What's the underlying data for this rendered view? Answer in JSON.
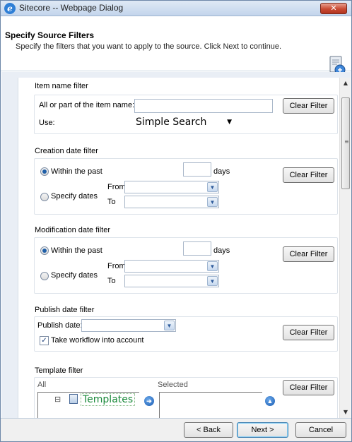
{
  "window": {
    "title": "Sitecore -- Webpage Dialog",
    "close_glyph": "✕"
  },
  "header": {
    "title": "Specify Source Filters",
    "subtitle": "Specify the filters that you want to apply to the source. Click Next to continue."
  },
  "item_name_filter": {
    "section_label": "Item name filter",
    "name_label": "All or part of the item name:",
    "name_value": "",
    "use_label": "Use:",
    "use_selected": "Simple Search",
    "clear_label": "Clear Filter"
  },
  "creation_date_filter": {
    "section_label": "Creation date filter",
    "within_label": "Within the past",
    "within_selected": true,
    "days_value": "",
    "days_label": "days",
    "specify_label": "Specify dates",
    "from_label": "From",
    "to_label": "To",
    "from_value": "",
    "to_value": "",
    "clear_label": "Clear Filter"
  },
  "modification_date_filter": {
    "section_label": "Modification date filter",
    "within_label": "Within the past",
    "within_selected": true,
    "days_value": "",
    "days_label": "days",
    "specify_label": "Specify dates",
    "from_label": "From",
    "to_label": "To",
    "from_value": "",
    "to_value": "",
    "clear_label": "Clear Filter"
  },
  "publish_date_filter": {
    "section_label": "Publish date filter",
    "date_label": "Publish date:",
    "date_value": "",
    "workflow_label": "Take workflow into account",
    "workflow_checked": true,
    "clear_label": "Clear Filter"
  },
  "template_filter": {
    "section_label": "Template filter",
    "all_label": "All",
    "selected_label": "Selected",
    "tree_root": "Templates",
    "tree_toggle": "⊟",
    "clear_label": "Clear Filter"
  },
  "footer": {
    "back_label": "< Back",
    "next_label": "Next >",
    "cancel_label": "Cancel"
  },
  "icons": {
    "app": "ie-icon",
    "header": "wizard-icon",
    "add": "arrow-right-icon",
    "remove": "arrow-up-icon"
  },
  "colors": {
    "accent": "#1f5fa8",
    "titlebar": "#c3d5ec",
    "tree_text": "#1a8a3a"
  }
}
